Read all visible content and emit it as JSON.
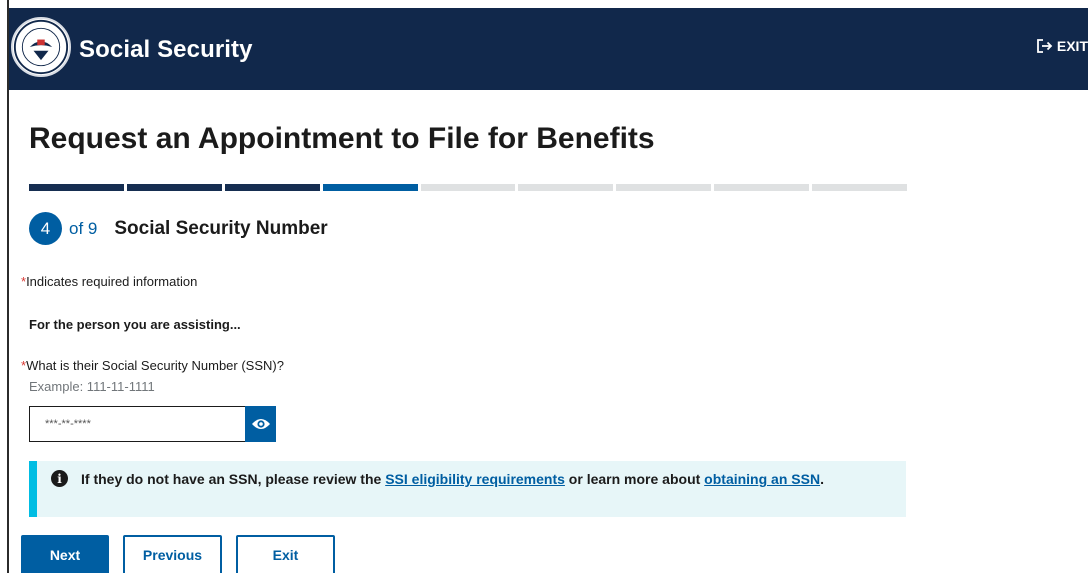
{
  "header": {
    "brand": "Social Security",
    "exit_label": "EXIT",
    "seal_icon": "ssa-seal-icon"
  },
  "page": {
    "title": "Request an Appointment to File for Benefits"
  },
  "progress": {
    "total_steps": 9,
    "completed_steps": 3,
    "current_step": 4,
    "step_number": "4",
    "step_of": "of 9",
    "step_name": "Social Security Number"
  },
  "form": {
    "required_marker": "*",
    "required_note": "Indicates required information",
    "assist_heading": "For the person you are assisting...",
    "ssn_question": "What is their Social Security Number (SSN)?",
    "ssn_hint": "Example: 111-11-1111",
    "ssn_value": "***-**-****",
    "show_icon": "eye-icon"
  },
  "alert": {
    "icon": "info-icon",
    "text_before": "If they do not have an SSN, please review the ",
    "link1": "SSI eligibility requirements",
    "text_middle": " or learn more about ",
    "link2": "obtaining an SSN",
    "text_after": "."
  },
  "buttons": {
    "next": "Next",
    "previous": "Previous",
    "exit": "Exit"
  },
  "colors": {
    "header_bg": "#11284b",
    "primary": "#005ea2",
    "step_done": "#162e51",
    "alert_bg": "#e7f6f8",
    "alert_border": "#00bde3",
    "required": "#d83933"
  }
}
